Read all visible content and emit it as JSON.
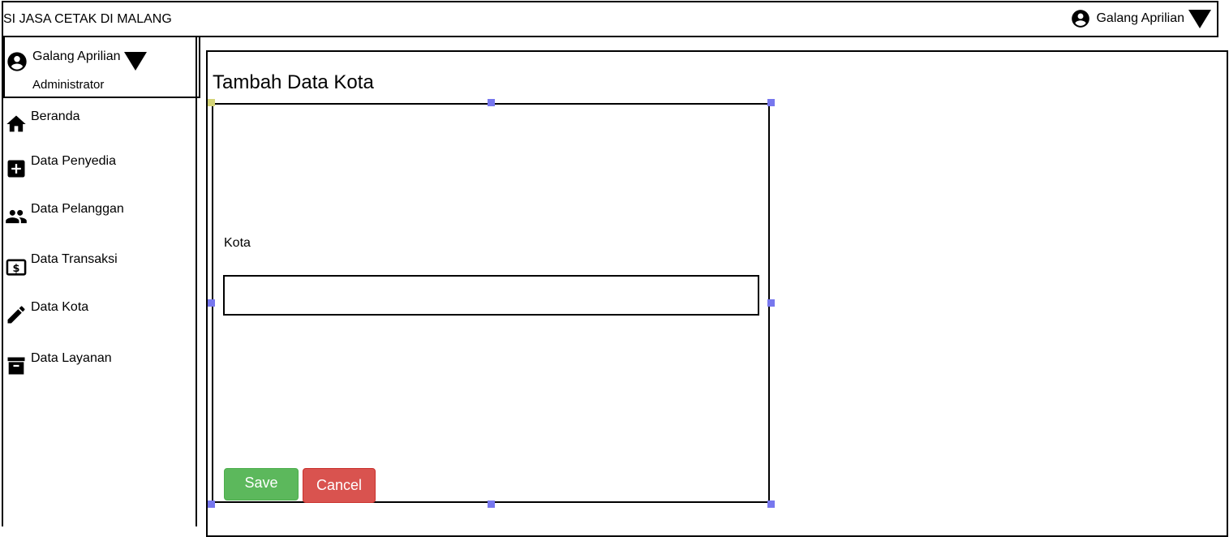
{
  "header": {
    "app_title": "SI JASA CETAK DI MALANG",
    "user_name": "Galang Aprilian",
    "user_icon": "account-circle-icon",
    "caret_icon": "caret-down-icon"
  },
  "sidebar": {
    "profile": {
      "name": "Galang Aprilian",
      "role": "Administrator"
    },
    "items": [
      {
        "label": "Beranda",
        "icon": "home-icon"
      },
      {
        "label": "Data Penyedia",
        "icon": "add-box-icon"
      },
      {
        "label": "Data Pelanggan",
        "icon": "people-icon"
      },
      {
        "label": "Data Transaksi",
        "icon": "money-icon"
      },
      {
        "label": "Data Kota",
        "icon": "pencil-icon"
      },
      {
        "label": "Data Layanan",
        "icon": "archive-icon"
      }
    ]
  },
  "main": {
    "page_title": "Tambah Data Kota",
    "form": {
      "field_label": "Kota",
      "field_value": "",
      "save_label": "Save",
      "cancel_label": "Cancel"
    }
  },
  "colors": {
    "save": "#5cb85c",
    "cancel": "#d9534f",
    "selection_handle": "#7777ee"
  }
}
